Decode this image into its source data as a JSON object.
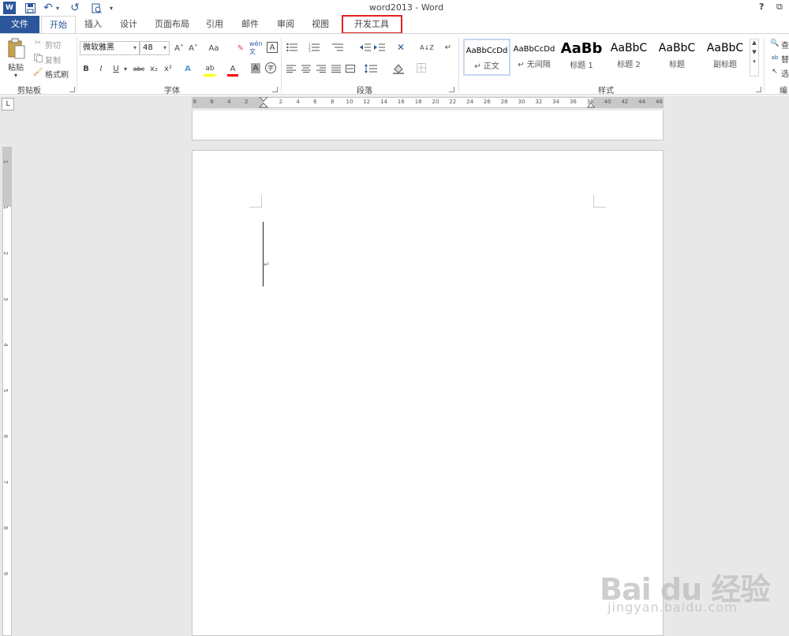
{
  "window": {
    "title": "word2013 - Word",
    "help": "?",
    "restore": "⧉"
  },
  "qat": {
    "undo_glyph": "↶",
    "redo_glyph": "↺",
    "more_glyph": "▾"
  },
  "tabs": [
    "文件",
    "开始",
    "插入",
    "设计",
    "页面布局",
    "引用",
    "邮件",
    "审阅",
    "视图",
    "开发工具"
  ],
  "active_tab": "开始",
  "highlighted_tab": "开发工具",
  "clipboard": {
    "paste": "粘贴",
    "cut": "剪切",
    "copy": "复制",
    "format_painter": "格式刷",
    "group": "剪贴板"
  },
  "font": {
    "family": "微软雅黑",
    "size": "48",
    "group": "字体",
    "grow": "A˄",
    "shrink": "A˅",
    "case": "Aa",
    "clear": "✎",
    "phonetic": "wén 文",
    "border": "A",
    "bold": "B",
    "italic": "I",
    "underline": "U",
    "strike": "abc",
    "sub": "x₂",
    "sup": "x²",
    "effects": "A",
    "highlight": "ab",
    "color": "A",
    "shading": "A",
    "enclose": "字"
  },
  "paragraph": {
    "group": "段落",
    "sort": "A↓Z",
    "pilcrow": "↵"
  },
  "styles": {
    "group": "样式",
    "items": [
      {
        "sample": "AaBbCcDd",
        "name": "↵ 正文"
      },
      {
        "sample": "AaBbCcDd",
        "name": "↵ 无间隔"
      },
      {
        "sample": "AaBb",
        "name": "标题 1"
      },
      {
        "sample": "AaBbC",
        "name": "标题 2"
      },
      {
        "sample": "AaBbC",
        "name": "标题"
      },
      {
        "sample": "AaBbC",
        "name": "副标题"
      }
    ]
  },
  "editing": {
    "find": "查",
    "replace": "替",
    "select": "选",
    "group": "编"
  },
  "ruler": {
    "h_numbers": [
      "8",
      "6",
      "4",
      "2",
      "2",
      "4",
      "6",
      "8",
      "10",
      "12",
      "14",
      "16",
      "18",
      "20",
      "22",
      "24",
      "26",
      "28",
      "30",
      "32",
      "34",
      "36",
      "38",
      "40",
      "42",
      "44",
      "46"
    ],
    "v_numbers": [
      "1",
      "1",
      "2",
      "3",
      "4",
      "5",
      "6",
      "7",
      "8",
      "9"
    ],
    "tab_selector": "L"
  },
  "watermark": {
    "brand": "Bai du 经验",
    "url": "jingyan.baidu.com"
  },
  "colors": {
    "accent": "#2b579a",
    "highlight_box": "#e32323",
    "font_color_bar": "#ff0000",
    "highlight_bar": "#ffff00"
  }
}
